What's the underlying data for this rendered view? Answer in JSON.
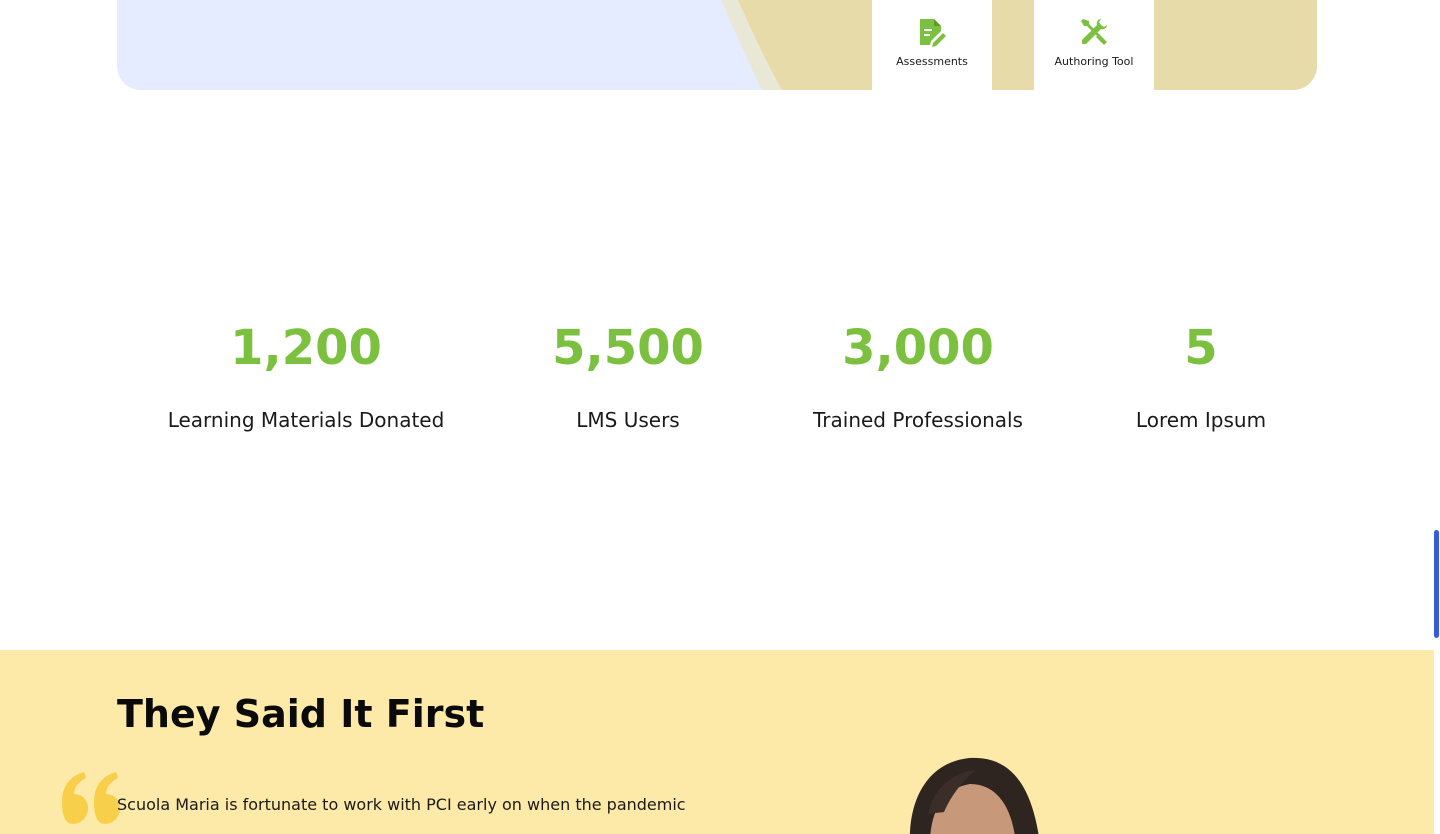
{
  "features": {
    "assessments": {
      "label": "Assessments",
      "icon": "edit-document-icon"
    },
    "authoring": {
      "label": "Authoring Tool",
      "icon": "tools-icon"
    }
  },
  "colors": {
    "accent_green": "#7cc040",
    "hero_blue": "#e6ecff",
    "hero_tan": "#e8dbaa",
    "testimonial_bg": "#fde9a8",
    "quote_yellow": "#f8cf4a",
    "scroll_blue": "#3a5bd9"
  },
  "stats": [
    {
      "value": "1,200",
      "label": "Learning Materials Donated"
    },
    {
      "value": "5,500",
      "label": "LMS Users"
    },
    {
      "value": "3,000",
      "label": "Trained Professionals"
    },
    {
      "value": "5",
      "label": "Lorem Ipsum"
    }
  ],
  "testimonials": {
    "heading": "They Said It First",
    "quote_icon": "quote-icon",
    "quote_text": "Scuola Maria is fortunate to work with PCI early on when the pandemic"
  }
}
